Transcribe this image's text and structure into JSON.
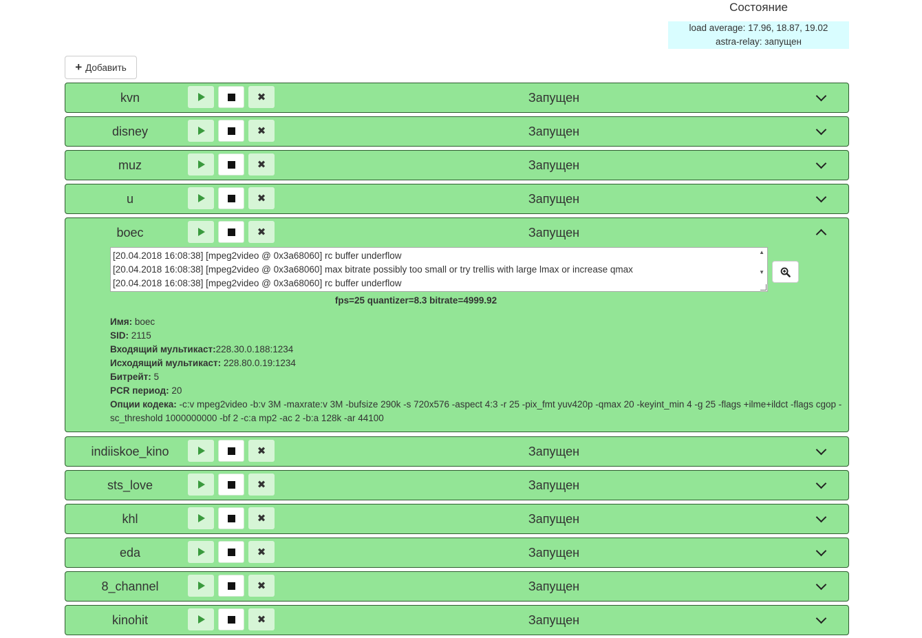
{
  "status": {
    "title": "Состояние",
    "load_average": "load average: 17.96, 18.87, 19.02",
    "relay_state": "astra-relay: запущен"
  },
  "toolbar": {
    "add_label": "Добавить"
  },
  "streams": [
    {
      "name": "kvn",
      "status": "Запущен"
    },
    {
      "name": "disney",
      "status": "Запущен"
    },
    {
      "name": "muz",
      "status": "Запущен"
    },
    {
      "name": "u",
      "status": "Запущен"
    },
    {
      "name": "boec",
      "status": "Запущен"
    },
    {
      "name": "indiiskoe_kino",
      "status": "Запущен"
    },
    {
      "name": "sts_love",
      "status": "Запущен"
    },
    {
      "name": "khl",
      "status": "Запущен"
    },
    {
      "name": "eda",
      "status": "Запущен"
    },
    {
      "name": "8_channel",
      "status": "Запущен"
    },
    {
      "name": "kinohit",
      "status": "Запущен"
    }
  ],
  "expanded": {
    "log": [
      "[20.04.2018 16:08:38]  [mpeg2video @ 0x3a68060] rc buffer underflow",
      "[20.04.2018 16:08:38]  [mpeg2video @ 0x3a68060] max bitrate possibly too small or try trellis with large lmax or increase qmax",
      "[20.04.2018 16:08:38]  [mpeg2video @ 0x3a68060] rc buffer underflow"
    ],
    "stats": "fps=25 quantizer=8.3 bitrate=4999.92",
    "details": {
      "name_label": "Имя:",
      "name_value": " boec",
      "sid_label": "SID:",
      "sid_value": " 2115",
      "in_label": "Входящий мультикаст:",
      "in_value": "228.30.0.188:1234",
      "out_label": "Исходящий мультикаст:",
      "out_value": " 228.80.0.19:1234",
      "bitrate_label": "Битрейт:",
      "bitrate_value": " 5",
      "pcr_label": "PCR период:",
      "pcr_value": " 20",
      "codec_label": "Опции кодека:",
      "codec_value": " -c:v mpeg2video -b:v 3M -maxrate:v 3M -bufsize 290k -s 720x576 -aspect 4:3 -r 25 -pix_fmt yuv420p -qmax 20 -keyint_min 4 -g 25 -flags +ilme+ildct -flags cgop -sc_threshold 1000000000 -bf 2 -c:a mp2 -ac 2 -b:a 128k -ar 44100"
    }
  },
  "colors": {
    "row_bg": "#93e596",
    "row_border": "#2e5c2f",
    "status_bg": "#d9fdff",
    "button_light": "#d6f5d6",
    "play_icon": "#3a9a3e"
  },
  "icons": {
    "add": "plus-icon",
    "play": "play-icon",
    "stop": "stop-icon",
    "delete": "close-icon",
    "toggle": "chevron-icon",
    "zoom": "zoom-in-icon"
  }
}
